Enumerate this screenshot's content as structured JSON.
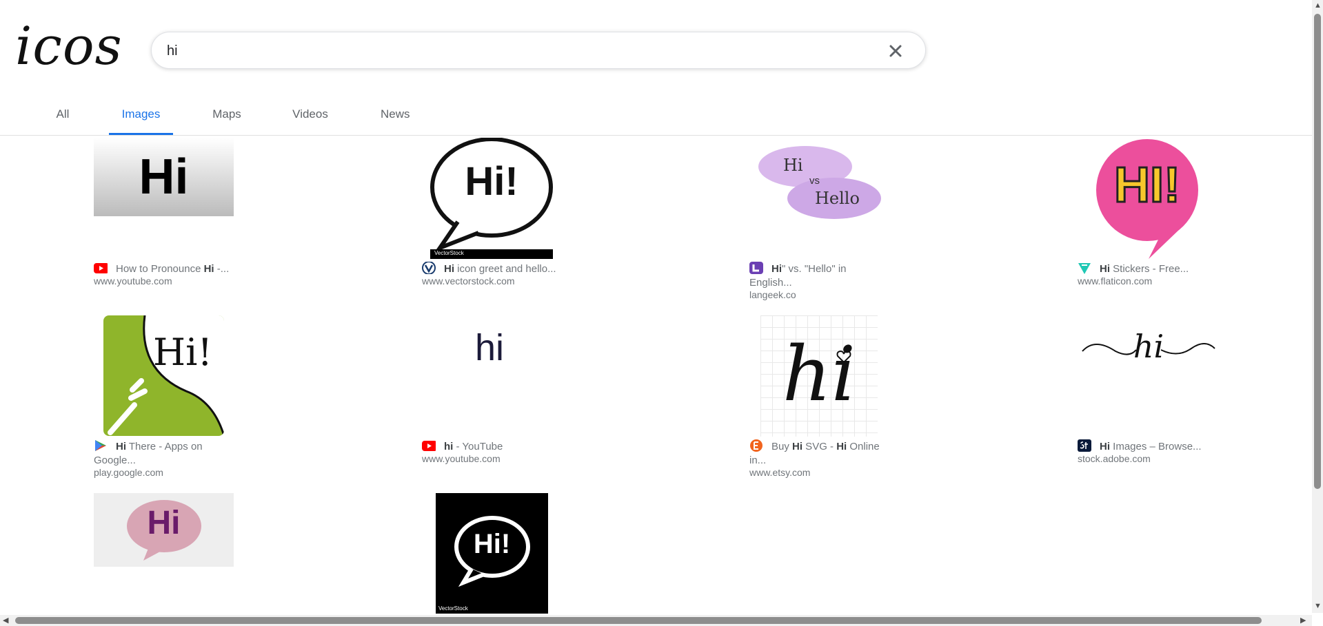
{
  "logo": "icos",
  "search": {
    "value": "hi"
  },
  "tabs": [
    "All",
    "Images",
    "Maps",
    "Videos",
    "News"
  ],
  "active_tab": "Images",
  "results": [
    {
      "title_bold": "Hi",
      "pre": "How to Pronounce ",
      "post": " -...",
      "source": "www.youtube.com",
      "fav": "youtube-icon"
    },
    {
      "title_bold": "Hi",
      "pre": "",
      "post": " icon greet and hello...",
      "source": "www.vectorstock.com",
      "fav": "vectorstock-icon"
    },
    {
      "title_bold": "Hi",
      "pre": "",
      "post": "\" vs. \"Hello\" in English...",
      "source": "langeek.co",
      "fav": "langeek-icon"
    },
    {
      "title_bold": "Hi",
      "pre": "",
      "post": " Stickers - Free...",
      "source": "www.flaticon.com",
      "fav": "flaticon-icon"
    },
    {
      "title_bold": "Hi",
      "pre": "",
      "post": " There - Apps on Google...",
      "source": "play.google.com",
      "fav": "google-play-icon"
    },
    {
      "title_bold": "hi",
      "pre": "",
      "post": " - YouTube",
      "source": "www.youtube.com",
      "fav": "youtube-icon"
    },
    {
      "title_bold": "Hi",
      "pre": "Buy ",
      "post": " SVG - ",
      "post_bold": "Hi",
      "post2": " Online in...",
      "source": "www.etsy.com",
      "fav": "etsy-icon"
    },
    {
      "title_bold": "Hi",
      "pre": "",
      "post": " Images – Browse...",
      "source": "stock.adobe.com",
      "fav": "adobe-stock-icon"
    }
  ],
  "image_text": {
    "r1c1": "Hi",
    "r1c2": "Hi!",
    "r1c3_a": "Hi",
    "r1c3_vs": "vs",
    "r1c3_b": "Hello",
    "r1c4": "HI!",
    "r2c1": "Hi!",
    "r2c2": "hi",
    "r2c3": "hi",
    "r2c4": "hi",
    "r3c1": "Hi",
    "r3c2": "Hi!",
    "vs_watermark": "VectorStock"
  },
  "colors": {
    "accent": "#1a73e8",
    "youtube": "#ff0000",
    "flaticon": "#1fc8b4",
    "etsy": "#f1641e"
  }
}
